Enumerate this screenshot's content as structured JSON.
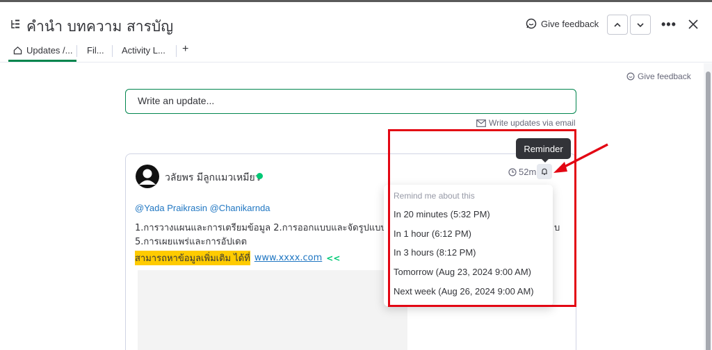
{
  "header": {
    "title": "คำนำ บทความ สารบัญ",
    "give_feedback": "Give feedback"
  },
  "tabs": [
    {
      "label": "Updates /..."
    },
    {
      "label": "Fil..."
    },
    {
      "label": "Activity L..."
    }
  ],
  "body": {
    "give_feedback": "Give feedback",
    "update_placeholder": "Write an update...",
    "email_link": "Write updates via email"
  },
  "post": {
    "author": "วลัยพร มีลูกแมวเหมียว",
    "time": "52m",
    "mentions": "@Yada Praikrasin @Chanikarnda",
    "line1": "1.การวางแผนและการเตรียมข้อมูล 2.การออกแบบและจัดรูปแบบ 3",
    "line1_tail": "บ",
    "line2": "5.การเผยแพร่และการอัปเดต",
    "highlight": "สามารถหาข้อมูลเพิ่มเติม ได้ที่",
    "link": "www.xxxx.com",
    "arrows": "<<"
  },
  "tooltip": "Reminder",
  "reminder_menu": {
    "header": "Remind me about this",
    "items": [
      "In 20 minutes (5:32 PM)",
      "In 1 hour (6:12 PM)",
      "In 3 hours (8:12 PM)",
      "Tomorrow (Aug 23, 2024 9:00 AM)",
      "Next week (Aug 26, 2024 9:00 AM)"
    ]
  },
  "colors": {
    "accent_green": "#00854d",
    "online": "#00c875",
    "link_blue": "#1f76c2",
    "highlight_yellow": "#ffcb00",
    "annotation_red": "#e30613"
  }
}
